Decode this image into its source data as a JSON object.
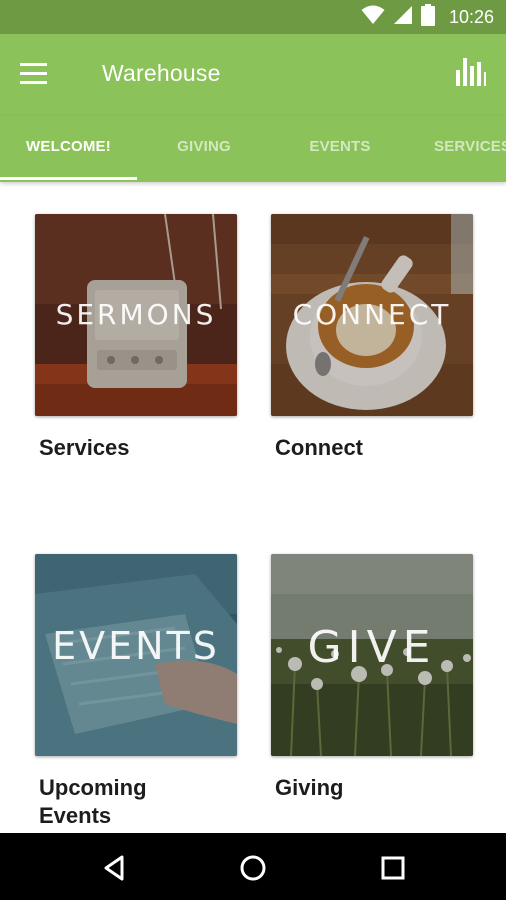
{
  "status_bar": {
    "time": "10:26",
    "icons": [
      "wifi-icon",
      "signal-icon",
      "battery-icon"
    ]
  },
  "app_bar": {
    "title": "Warehouse",
    "menu_icon": "hamburger-menu-icon",
    "action_icon": "bar-chart-icon"
  },
  "tabs": [
    {
      "label": "WELCOME!",
      "active": true
    },
    {
      "label": "GIVING",
      "active": false
    },
    {
      "label": "EVENTS",
      "active": false
    },
    {
      "label": "SERVICES",
      "active": false
    }
  ],
  "cards": [
    {
      "overlay": "SERMONS",
      "caption": "Services",
      "image": "vintage-radio-photo"
    },
    {
      "overlay": "CONNECT",
      "caption": "Connect",
      "image": "coffee-cup-photo"
    },
    {
      "overlay": "EVENTS",
      "caption": "Upcoming Events",
      "image": "hand-on-paper-photo"
    },
    {
      "overlay": "GIVE",
      "caption": "Giving",
      "image": "dandelion-field-photo"
    }
  ],
  "nav_bar": {
    "icons": [
      "back-icon",
      "home-icon",
      "recents-icon"
    ]
  },
  "colors": {
    "status_bar": "#6e9a44",
    "app_bar": "#8cc25a",
    "tab_active": "#ffffff",
    "tab_inactive": "rgba(255,255,255,0.62)",
    "caption_text": "#1d1d1d",
    "nav_bar": "#000000"
  }
}
